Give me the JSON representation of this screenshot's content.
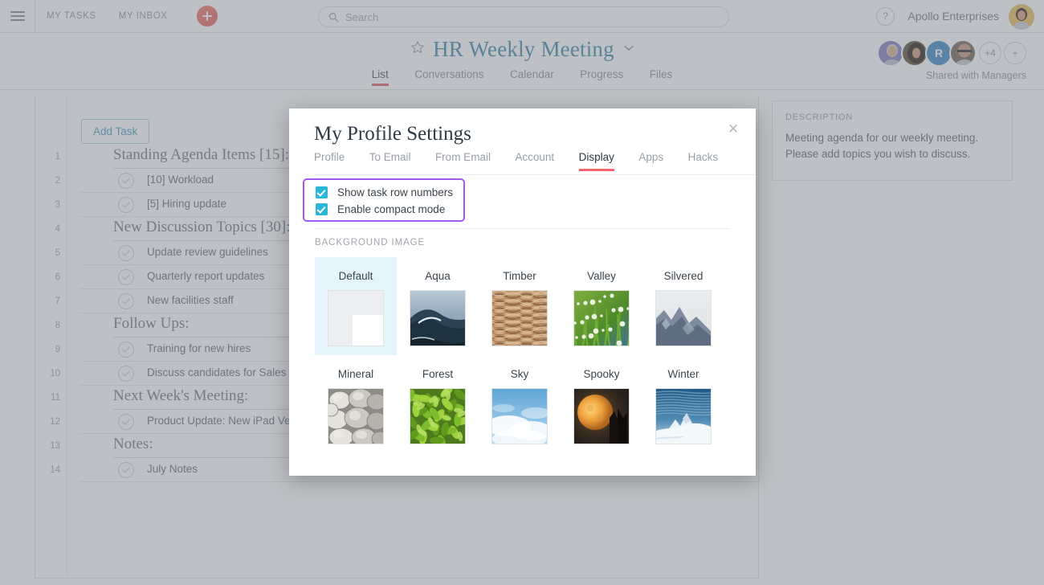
{
  "topbar": {
    "hamburger_icon": "hamburger-menu-icon",
    "links": [
      {
        "label": "MY TASKS"
      },
      {
        "label": "MY INBOX"
      }
    ],
    "add_button_icon": "plus-icon",
    "search": {
      "placeholder": "Search",
      "value": "",
      "icon": "search-icon"
    },
    "help_label": "?",
    "org_name": "Apollo Enterprises",
    "avatar_icon": "user-avatar"
  },
  "project_header": {
    "star_icon": "star-outline-icon",
    "title": "HR Weekly Meeting",
    "caret_icon": "chevron-down-icon",
    "tabs": [
      {
        "label": "List",
        "active": true
      },
      {
        "label": "Conversations",
        "active": false
      },
      {
        "label": "Calendar",
        "active": false
      },
      {
        "label": "Progress",
        "active": false
      },
      {
        "label": "Files",
        "active": false
      }
    ],
    "collapse_icon": "double-chevron-up-icon",
    "members": [
      {
        "type": "photo",
        "label": ""
      },
      {
        "type": "photo",
        "label": ""
      },
      {
        "type": "initial",
        "label": "R"
      },
      {
        "type": "photo",
        "label": ""
      }
    ],
    "more_members": "+4",
    "add_member": "+",
    "shared_label": "Shared with Managers",
    "accent_color": "#4a90ad",
    "tab_underline_color": "#e06b74"
  },
  "task_list": {
    "add_task_label": "Add Task",
    "rows": [
      {
        "num": "1",
        "type": "section",
        "label": "Standing Agenda Items [15]:"
      },
      {
        "num": "2",
        "type": "task",
        "label": "[10] Workload"
      },
      {
        "num": "3",
        "type": "task",
        "label": "[5] Hiring update"
      },
      {
        "num": "4",
        "type": "section",
        "label": "New Discussion Topics [30]:"
      },
      {
        "num": "5",
        "type": "task",
        "label": "Update review guidelines"
      },
      {
        "num": "6",
        "type": "task",
        "label": "Quarterly report updates"
      },
      {
        "num": "7",
        "type": "task",
        "label": "New facilities staff"
      },
      {
        "num": "8",
        "type": "section",
        "label": "Follow Ups:"
      },
      {
        "num": "9",
        "type": "task",
        "label": "Training for new hires"
      },
      {
        "num": "10",
        "type": "task",
        "label": "Discuss candidates for Sales Manager"
      },
      {
        "num": "11",
        "type": "section",
        "label": "Next Week's Meeting:"
      },
      {
        "num": "12",
        "type": "task",
        "label": "Product Update: New iPad Version"
      },
      {
        "num": "13",
        "type": "section",
        "label": "Notes:"
      },
      {
        "num": "14",
        "type": "task",
        "label": "July Notes"
      }
    ]
  },
  "description_panel": {
    "title": "DESCRIPTION",
    "line1": "Meeting agenda for our weekly meeting.",
    "line2": "Please add topics you wish to discuss."
  },
  "modal": {
    "title": "My Profile Settings",
    "close_icon": "close-icon",
    "tabs": [
      {
        "label": "Profile",
        "active": false
      },
      {
        "label": "To Email",
        "active": false
      },
      {
        "label": "From Email",
        "active": false
      },
      {
        "label": "Account",
        "active": false
      },
      {
        "label": "Display",
        "active": true
      },
      {
        "label": "Apps",
        "active": false
      },
      {
        "label": "Hacks",
        "active": false
      }
    ],
    "active_tab_color": "#f4646e",
    "highlight_border_color": "#a259f0",
    "checkbox_color": "#29b6d8",
    "options": [
      {
        "label": "Show task row numbers",
        "checked": true
      },
      {
        "label": "Enable compact mode",
        "checked": true
      }
    ],
    "background_section": {
      "title": "BACKGROUND IMAGE",
      "selected": "Default",
      "items": [
        {
          "name": "Default",
          "kind": "default",
          "selected": true
        },
        {
          "name": "Aqua",
          "kind": "wave",
          "selected": false
        },
        {
          "name": "Timber",
          "kind": "wood",
          "selected": false
        },
        {
          "name": "Valley",
          "kind": "grass",
          "selected": false
        },
        {
          "name": "Silvered",
          "kind": "mountain",
          "selected": false
        },
        {
          "name": "Mineral",
          "kind": "stones",
          "selected": false
        },
        {
          "name": "Forest",
          "kind": "leaves",
          "selected": false
        },
        {
          "name": "Sky",
          "kind": "clouds",
          "selected": false
        },
        {
          "name": "Spooky",
          "kind": "moon",
          "selected": false
        },
        {
          "name": "Winter",
          "kind": "snow",
          "selected": false
        }
      ]
    }
  }
}
